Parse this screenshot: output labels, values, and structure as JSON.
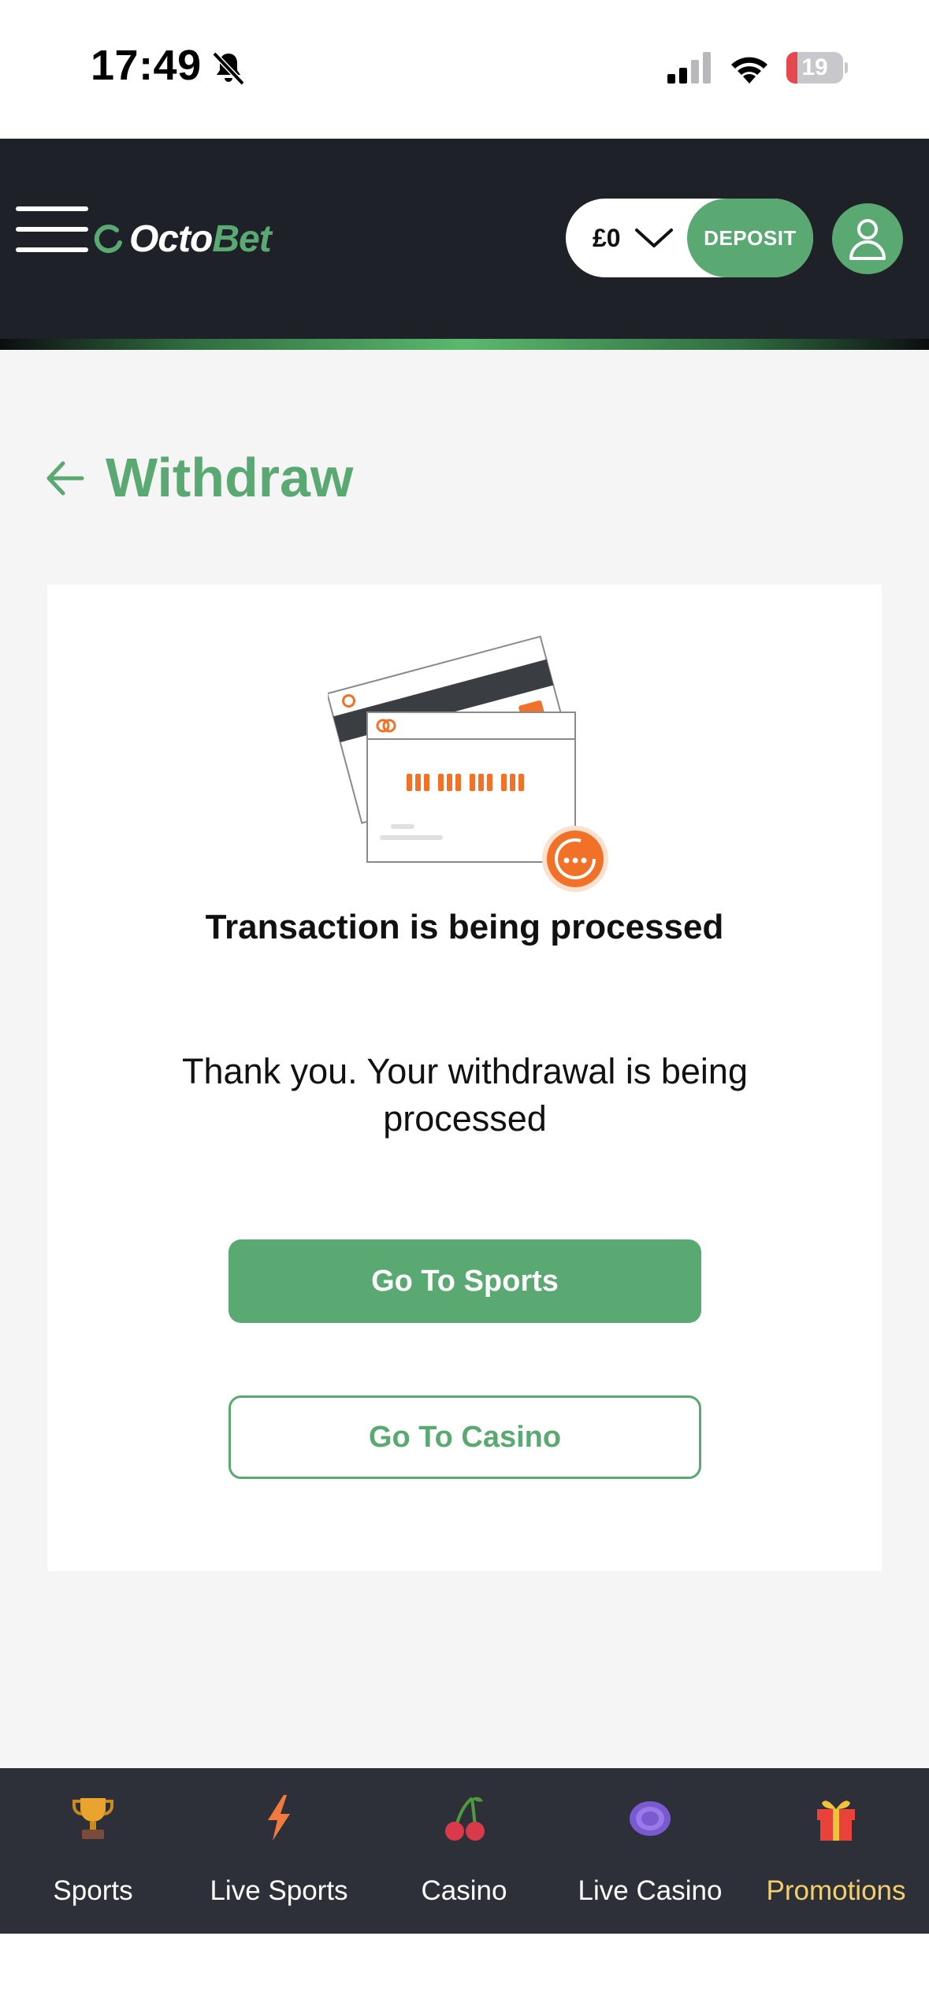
{
  "status_bar": {
    "time": "17:49",
    "battery": "19",
    "battery_level": 0.19
  },
  "header": {
    "logo_octo": "Octo",
    "logo_bet": "Bet",
    "balance": "£0",
    "deposit_label": "DEPOSIT"
  },
  "page": {
    "title": "Withdraw"
  },
  "transaction": {
    "title": "Transaction is being processed",
    "message": "Thank you. Your withdrawal is being processed",
    "go_to_sports": "Go To Sports",
    "go_to_casino": "Go To Casino"
  },
  "bottom_nav": {
    "items": [
      {
        "label": "Sports",
        "icon": "trophy-icon"
      },
      {
        "label": "Live Sports",
        "icon": "lightning-icon"
      },
      {
        "label": "Casino",
        "icon": "cherries-icon"
      },
      {
        "label": "Live Casino",
        "icon": "casino-chip-icon"
      },
      {
        "label": "Promotions",
        "icon": "gift-icon",
        "active": true
      }
    ]
  },
  "colors": {
    "brand_green": "#5aa872",
    "header_bg": "#1f2128",
    "nav_bg": "#2d3038",
    "active_nav": "#f2d06b",
    "accent_orange": "#f07127"
  }
}
